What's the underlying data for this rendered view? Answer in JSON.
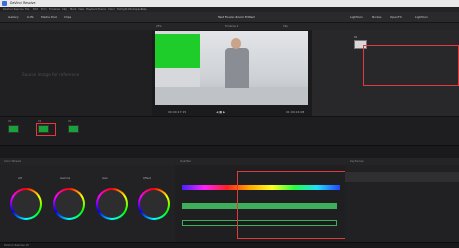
{
  "window": {
    "title": "DaVinci Resolve"
  },
  "menu": [
    "DaVinci Resolve",
    "File",
    "Edit",
    "Trim",
    "Timeline",
    "Clip",
    "Mark",
    "View",
    "Playback",
    "Fusion",
    "Color",
    "Fairlight",
    "Workspace",
    "Help"
  ],
  "toolbar": {
    "left": [
      "Gallery",
      "LUTs",
      "Media Pool",
      "Clips"
    ],
    "center": "Test Fusion Zoom Edited",
    "right": [
      "Lightbox",
      "Nodes",
      "OpenFX",
      "Lightbox"
    ]
  },
  "subbar": {
    "center": "Timeline 1",
    "zoom": "25%",
    "clip": "Clip"
  },
  "gallery": {
    "message": "Source image for reference"
  },
  "viewer": {
    "timecode_left": "00:00:17:15",
    "timecode_right": "01:00:24:08"
  },
  "nodes": {
    "node_label": "01"
  },
  "clips": [
    {
      "label": "V1"
    },
    {
      "label": "V1"
    },
    {
      "label": "V1"
    }
  ],
  "panels": {
    "wheels_title": "Color Wheels",
    "hsl_title": "Qualifier",
    "keyer_title": "Keyframes"
  },
  "wheels": [
    {
      "label": "Lift"
    },
    {
      "label": "Gamma"
    },
    {
      "label": "Gain"
    },
    {
      "label": "Offset"
    }
  ],
  "statusbar": {
    "app": "DaVinci Resolve 15"
  }
}
